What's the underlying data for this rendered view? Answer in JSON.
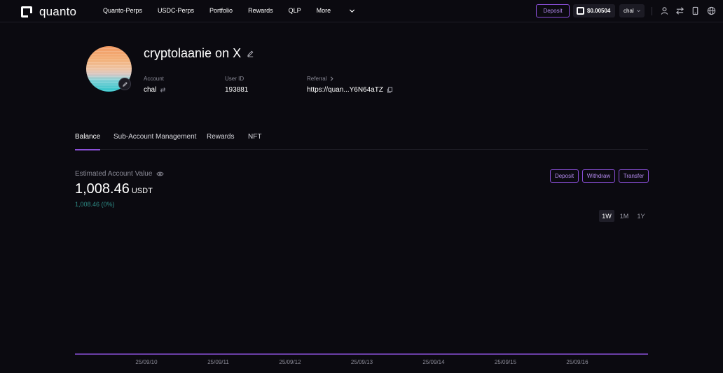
{
  "brand": {
    "name": "quanto"
  },
  "nav": [
    "Quanto-Perps",
    "USDC-Perps",
    "Portfolio",
    "Rewards",
    "QLP",
    "More"
  ],
  "topbar": {
    "deposit_label": "Deposit",
    "wallet_balance": "$0.00504",
    "account_selector": "chal"
  },
  "profile": {
    "username": "cryptolaanie on X",
    "account_label": "Account",
    "account_value": "chal",
    "userid_label": "User ID",
    "userid_value": "193881",
    "referral_label": "Referral",
    "referral_value": "https://quan...Y6N64aTZ"
  },
  "tabs": [
    "Balance",
    "Sub-Account Management",
    "Rewards",
    "NFT"
  ],
  "active_tab": "Balance",
  "balance": {
    "label": "Estimated Account Value",
    "value": "1,008.46",
    "unit": "USDT",
    "change": "1,008.46 (0%)",
    "actions": {
      "deposit": "Deposit",
      "withdraw": "Withdraw",
      "transfer": "Transfer"
    },
    "ranges": [
      "1W",
      "1M",
      "1Y"
    ],
    "active_range": "1W"
  },
  "colors": {
    "accent": "#8a4fd8",
    "change": "#2f8e88",
    "background": "#0b0a10"
  },
  "chart_data": {
    "type": "line",
    "x": [
      "25/09/10",
      "25/09/11",
      "25/09/12",
      "25/09/13",
      "25/09/14",
      "25/09/15",
      "25/09/16"
    ],
    "series": [
      {
        "values": [
          1008.46,
          1008.46,
          1008.46,
          1008.46,
          1008.46,
          1008.46,
          1008.46
        ]
      }
    ],
    "grid": false
  }
}
